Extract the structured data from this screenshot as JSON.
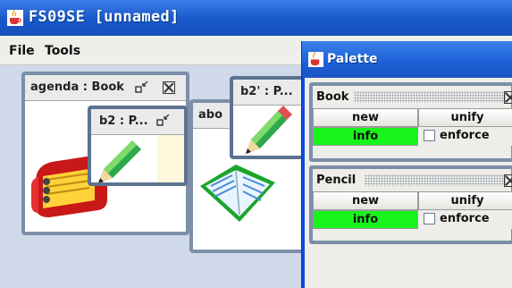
{
  "window": {
    "title": "FS09SE [unnamed]"
  },
  "menu": {
    "items": [
      "File",
      "Tools"
    ]
  },
  "frames": {
    "agenda": {
      "title": "agenda : Book"
    },
    "b2": {
      "title": "b2 : P..."
    },
    "abo": {
      "title": "abo"
    },
    "b2prime": {
      "title": "b2' : P..."
    }
  },
  "palette": {
    "title": "Palette",
    "panels": [
      {
        "label": "Book",
        "new_label": "new",
        "unify_label": "unify",
        "info_label": "info",
        "enforce_label": "enforce"
      },
      {
        "label": "Pencil",
        "new_label": "new",
        "unify_label": "unify",
        "info_label": "info",
        "enforce_label": "enforce"
      }
    ]
  },
  "colors": {
    "titlebar": "#1758c9",
    "info_green": "#19f41b",
    "frame_border": "#7c8ea8"
  },
  "icons": [
    "java-cup-icon",
    "minimize-icon",
    "close-icon",
    "agenda-book-icon",
    "pencil-icon",
    "open-book-icon"
  ]
}
